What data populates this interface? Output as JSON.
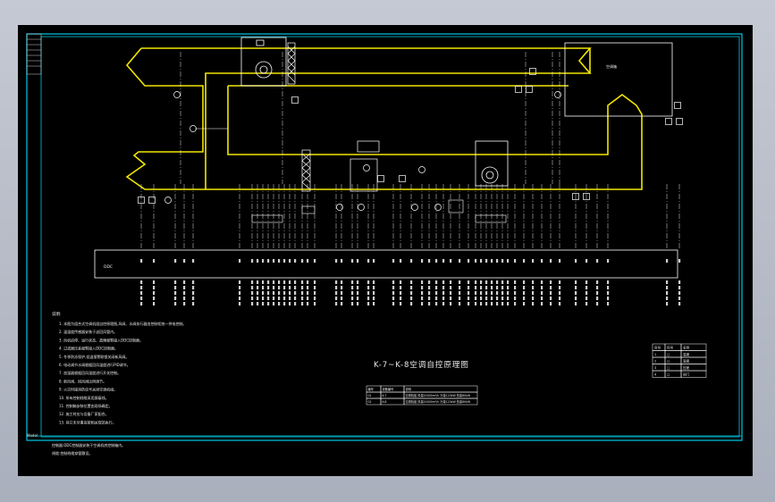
{
  "drawing": {
    "title": "K-7~K-8空调自控原理图",
    "notes_heading": "说明:",
    "note_lines": [
      "1. 本图为组合式空调机组自控原理图,风阀、水阀执行器由控制柜统一供电控制。",
      "2. 温湿度传感器安装于送回风管内。",
      "3. 风机启停、运行状态、故障报警接入DDC控制器。",
      "4. 过滤器压差报警接入DDC控制器。",
      "5. 冬季防冻保护,低温报警联锁关闭新风阀。",
      "6. 电动调节水阀根据回风温度进行PID调节。",
      "7. 加湿器根据回风湿度进行开关控制。",
      "8. 新风阀、回风阀比例调节。",
      "9. 火灾时接消防信号关闭空调机组。",
      "10. 所有控制线缆采用屏蔽线。",
      "11. 控制箱安装位置由现场确定。",
      "12. 施工时应与设备厂家配合。",
      "13. 其它未尽事宜按相关规范执行。"
    ],
    "extra_notes": [
      "控制器:DDC控制器安装于空调机房控制箱内。",
      "线缆:控制线缆穿管敷设。"
    ],
    "ddc_label": "DDC",
    "box_label": "空调箱",
    "left_margin_label": "Model"
  },
  "schedule_table": {
    "headers": [
      "编号",
      "设备编号",
      "说明"
    ],
    "rows": [
      [
        "01",
        "K-7",
        "空调机组 风量20000m³/h 冷量120kW 热量80kW"
      ],
      [
        "02",
        "K-8",
        "空调机组 风量20000m³/h 冷量120kW 热量80kW"
      ]
    ]
  },
  "legend_table": {
    "headers": [
      "序号",
      "符号",
      "名称"
    ],
    "rows": [
      [
        "1",
        "□",
        "温度"
      ],
      [
        "2",
        "□",
        "湿度"
      ],
      [
        "3",
        "□",
        "压差"
      ],
      [
        "4",
        "□",
        "阀门"
      ]
    ]
  },
  "colors": {
    "duct": "#f2e600",
    "border": "#00c8e6",
    "line": "#ffffff",
    "text": "#e8e8e8"
  }
}
